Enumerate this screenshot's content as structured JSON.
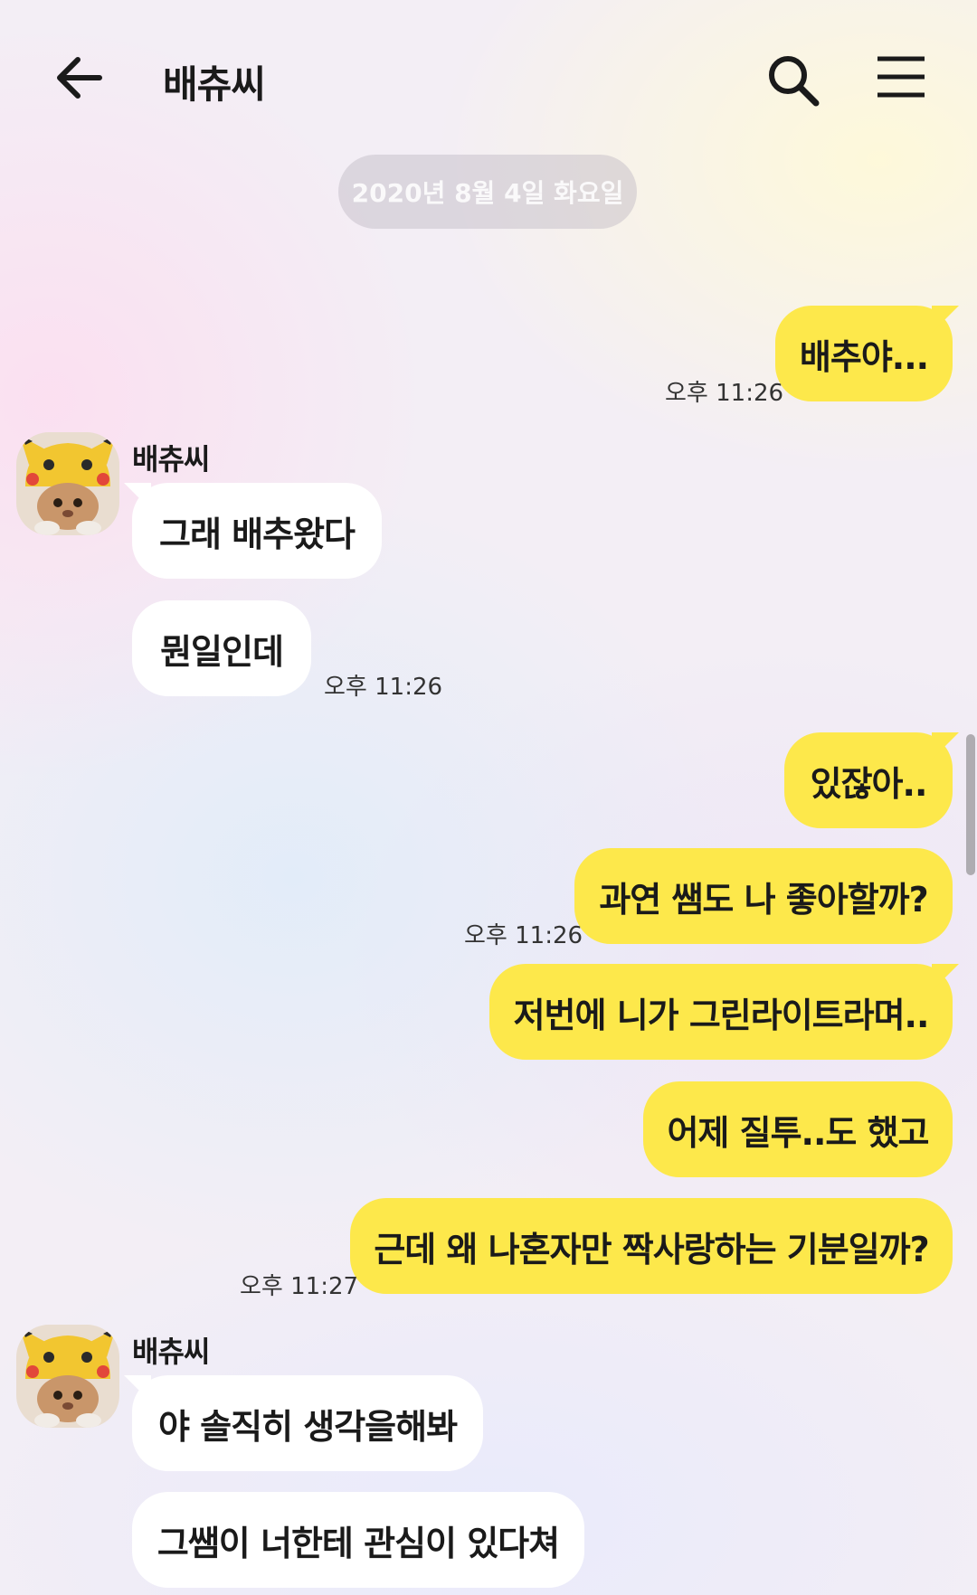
{
  "header": {
    "title": "배츄씨",
    "back_icon": "arrow-left-icon",
    "search_icon": "search-icon",
    "menu_icon": "hamburger-menu-icon"
  },
  "date_divider": "2020년 8월 4일 화요일",
  "colors": {
    "my_bubble": "#fde84b",
    "other_bubble": "#ffffff"
  },
  "messages": [
    {
      "sender": "me",
      "text": "배추야..."
    },
    {
      "time": "오후 11:26"
    },
    {
      "sender_name": "배츄씨"
    },
    {
      "sender": "other",
      "text": "그래 배추왔다"
    },
    {
      "sender": "other",
      "text": "뭔일인데"
    },
    {
      "time": "오후 11:26"
    },
    {
      "sender": "me",
      "text": "있잖아.."
    },
    {
      "sender": "me",
      "text": "과연 쌤도 나 좋아할까?"
    },
    {
      "time": "오후 11:26"
    },
    {
      "sender": "me",
      "text": "저번에 니가 그린라이트라며.."
    },
    {
      "sender": "me",
      "text": "어제 질투..도 했고"
    },
    {
      "sender": "me",
      "text": "근데 왜 나혼자만 짝사랑하는 기분일까?"
    },
    {
      "time": "오후 11:27"
    },
    {
      "sender_name": "배츄씨"
    },
    {
      "sender": "other",
      "text": "야 솔직히 생각을해봐"
    },
    {
      "sender": "other",
      "text": "그쌤이 너한테 관심이 있다쳐"
    }
  ]
}
